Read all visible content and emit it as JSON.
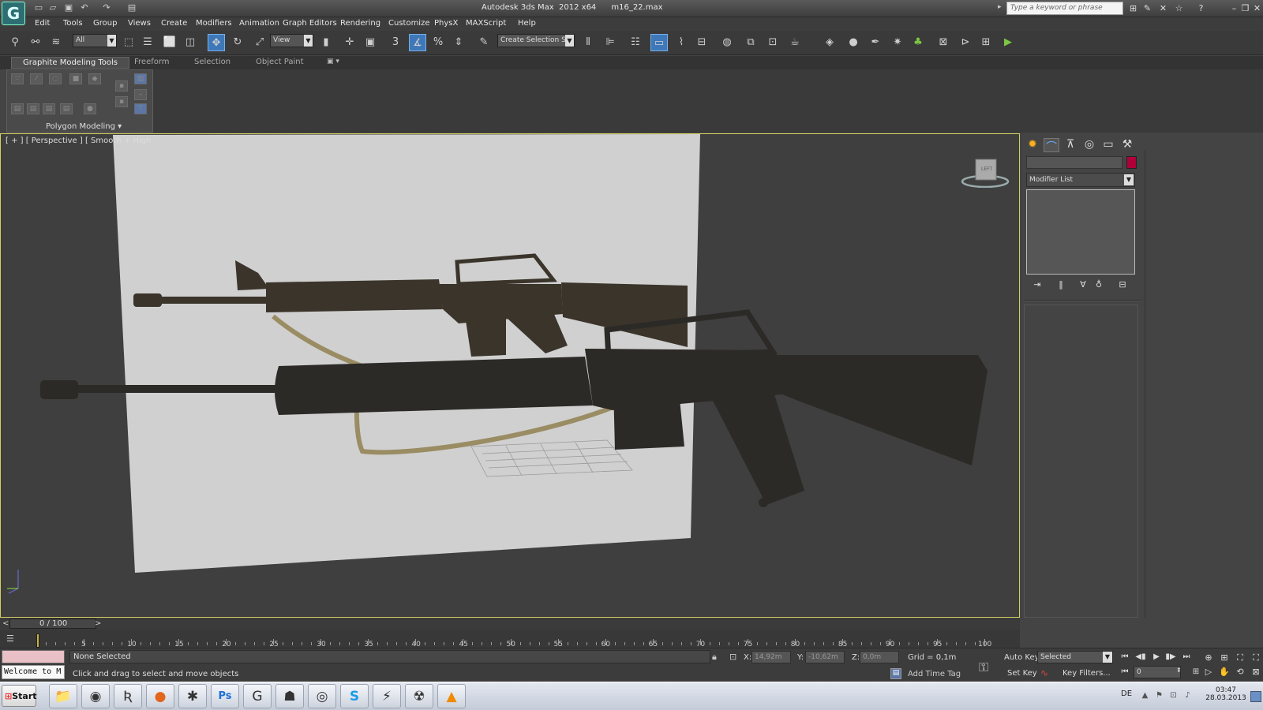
{
  "app": {
    "title": "Autodesk 3ds Max  2012 x64      m16_22.max",
    "logo_letter": "G",
    "search_placeholder": "Type a keyword or phrase"
  },
  "menus": [
    "Edit",
    "Tools",
    "Group",
    "Views",
    "Create",
    "Modifiers",
    "Animation",
    "Graph Editors",
    "Rendering",
    "Customize",
    "PhysX",
    "MAXScript",
    "Help"
  ],
  "toolbar": {
    "filter_dropdown": "All",
    "ref_coord_dropdown": "View",
    "snap_label": "3",
    "selection_set_dropdown": "Create Selection Se"
  },
  "ribbon": {
    "tabs": [
      "Graphite Modeling Tools",
      "Freeform",
      "Selection",
      "Object Paint"
    ],
    "active_tab": 0,
    "panel_label": "Polygon Modeling ▾"
  },
  "viewport": {
    "label": "[ + ] [ Perspective ] [ Smooth + High",
    "viewcube_label": "LEFT",
    "colors": {
      "border": "#d4cf62",
      "background": "#3f3f3f",
      "ref_plane": "#d0d0d0",
      "rifle": "#2c2a26",
      "sling": "#9a8c63"
    }
  },
  "command_panel": {
    "modifier_list": "Modifier List",
    "object_color": "#b0003a"
  },
  "timeline": {
    "position_label": "0 / 100",
    "prev_arrow": "<",
    "next_arrow": ">",
    "tick_numbers": [
      5,
      10,
      15,
      20,
      25,
      30,
      35,
      40,
      45,
      50,
      55,
      60,
      65,
      70,
      75,
      80,
      85,
      90,
      95,
      100
    ],
    "current_frame": 0,
    "total_frames": 100
  },
  "status": {
    "welcome": "Welcome to M",
    "selection_state": "None Selected",
    "prompt": "Click and drag to select and move objects",
    "x_label": "X:",
    "x_value": "14,92m",
    "y_label": "Y:",
    "y_value": "-10,62m",
    "z_label": "Z:",
    "z_value": "0,0m",
    "grid": "Grid = 0,1m",
    "add_time_tag": "Add Time Tag",
    "auto_key": "Auto Key",
    "set_key": "Set Key",
    "key_mode_dropdown": "Selected",
    "key_filters": "Key Filters...",
    "frame_field": "0"
  },
  "taskbar": {
    "start_label": "Start",
    "apps": [
      {
        "name": "explorer",
        "glyph": "📁"
      },
      {
        "name": "browser-ie",
        "glyph": "◉"
      },
      {
        "name": "app-r",
        "glyph": "Ʀ"
      },
      {
        "name": "firefox",
        "glyph": "●"
      },
      {
        "name": "zbrush",
        "glyph": "✱"
      },
      {
        "name": "photoshop",
        "glyph": "Ps"
      },
      {
        "name": "3dsmax",
        "glyph": "G"
      },
      {
        "name": "app-a",
        "glyph": "☗"
      },
      {
        "name": "media-player",
        "glyph": "◎"
      },
      {
        "name": "skype",
        "glyph": "S"
      },
      {
        "name": "app-lightning",
        "glyph": "⚡"
      },
      {
        "name": "app-radioactive",
        "glyph": "☢"
      },
      {
        "name": "vlc",
        "glyph": "▲"
      }
    ],
    "language": "DE",
    "time": "03:47",
    "date": "28.03.2013"
  }
}
